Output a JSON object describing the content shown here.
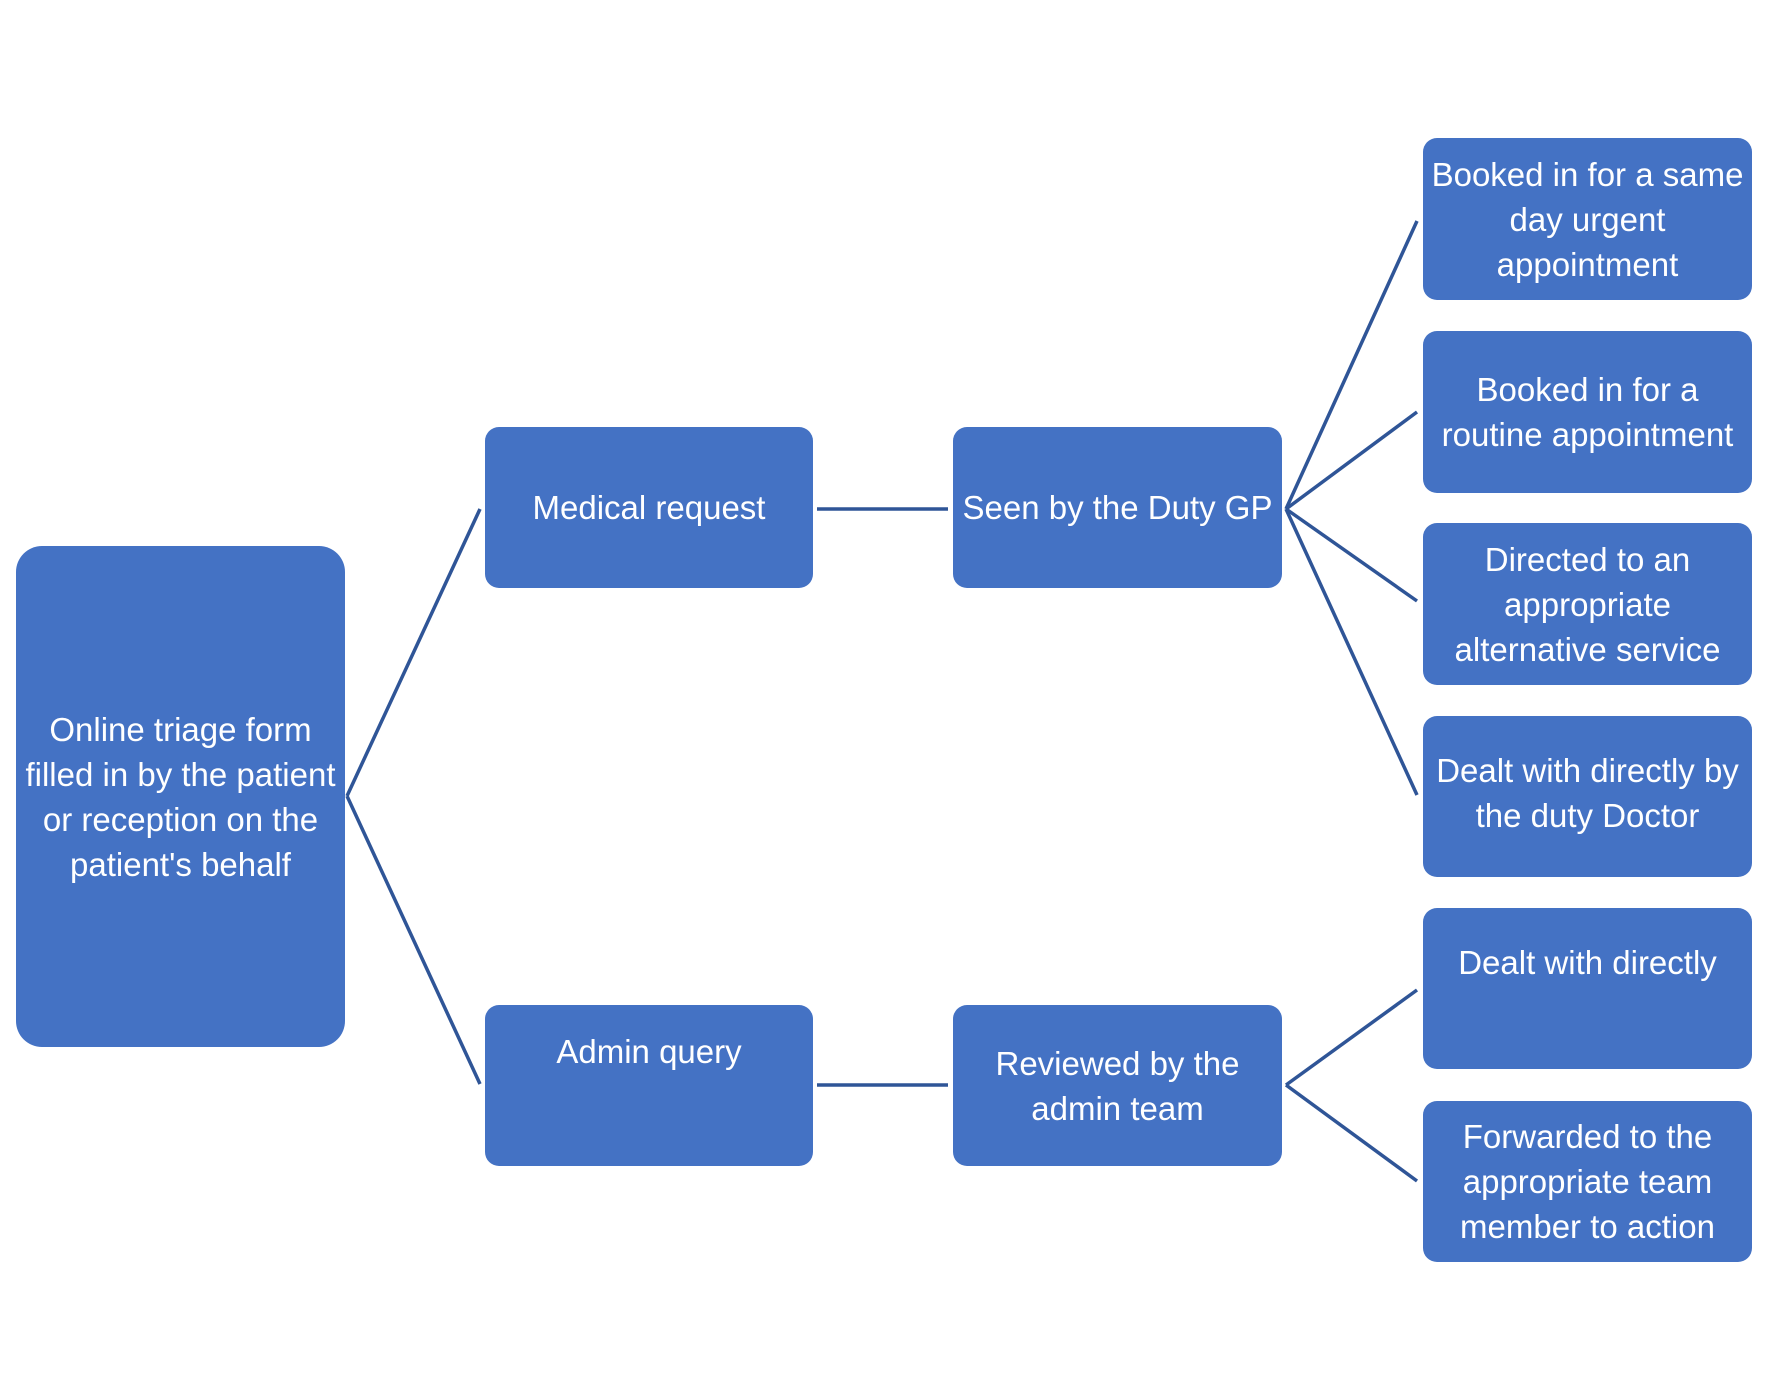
{
  "colors": {
    "box_fill": "#4472C4",
    "connector": "#2F5597",
    "text": "#FFFFFF"
  },
  "root": "Online triage form filled in by the patient or reception on the patient's behalf",
  "branches": {
    "medical": {
      "label": "Medical request",
      "reviewer": "Seen by the Duty GP",
      "outcomes": [
        "Booked in for a same day urgent appointment",
        "Booked in for a routine appointment",
        "Directed to an appropriate alternative service",
        "Dealt with directly by the duty Doctor"
      ]
    },
    "admin": {
      "label": "Admin query",
      "reviewer": "Reviewed by the admin team",
      "outcomes": [
        "Dealt with directly",
        "Forwarded to the appropriate team member to action"
      ]
    }
  }
}
